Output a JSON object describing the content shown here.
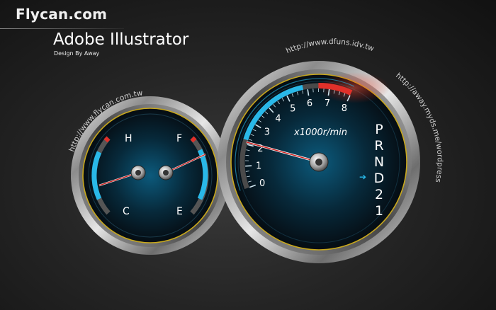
{
  "header": {
    "logo": "Flycan.com",
    "title": "Adobe Illustrator",
    "subtitle": "Design By Away"
  },
  "urls": {
    "left_gauge": "http://www.flycan.com.tw",
    "top": "http://www.dfuns.idv.tw",
    "right": "http://away.myds.me/wordpress"
  },
  "small_gauge": {
    "temp_hot": "H",
    "temp_cold": "C",
    "fuel_full": "F",
    "fuel_empty": "E"
  },
  "tachometer": {
    "scale": [
      "0",
      "1",
      "2",
      "3",
      "4",
      "5",
      "6",
      "7",
      "8"
    ],
    "unit": "x1000r/min",
    "needle_value": 2.1,
    "redline_start": 6.5,
    "gears": [
      "P",
      "R",
      "N",
      "D",
      "2",
      "1"
    ]
  },
  "colors": {
    "accent": "#29b8e8",
    "needle": "#d01818",
    "redline": "#e0302a",
    "ring": "#c8a81c"
  }
}
